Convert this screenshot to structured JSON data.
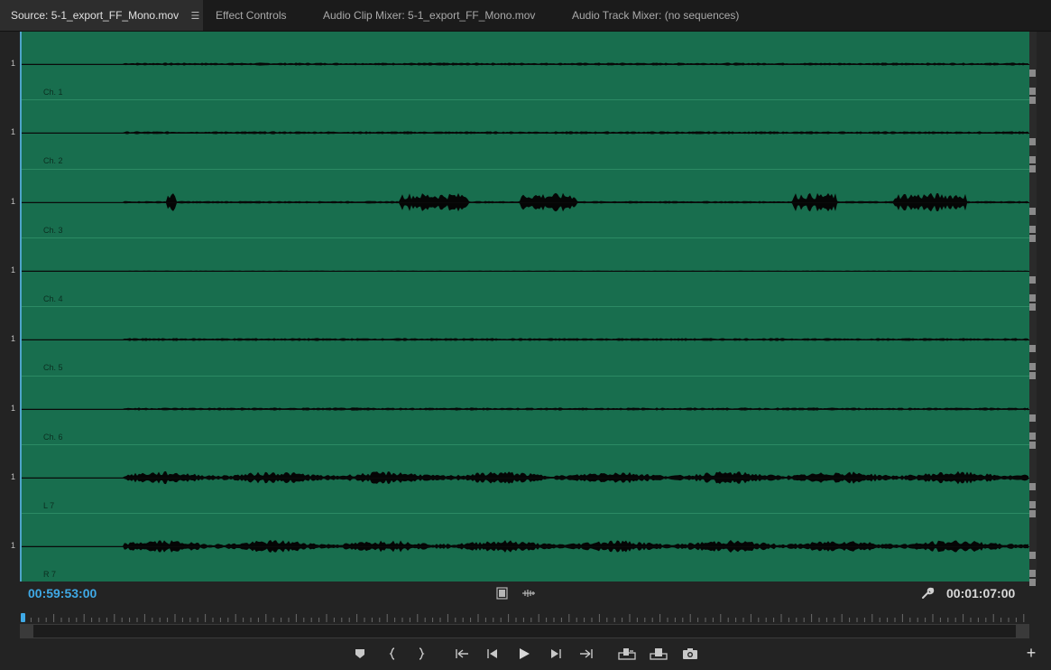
{
  "tabs": [
    {
      "label": "Source: 5-1_export_FF_Mono.mov",
      "active": true
    },
    {
      "label": "Effect Controls",
      "active": false
    },
    {
      "label": "Audio Clip Mixer: 5-1_export_FF_Mono.mov",
      "active": false
    },
    {
      "label": "Audio Track Mixer: (no sequences)",
      "active": false
    }
  ],
  "channels": [
    {
      "label": "Ch. 1",
      "scale": "1",
      "level": "low"
    },
    {
      "label": "Ch. 2",
      "scale": "1",
      "level": "low"
    },
    {
      "label": "Ch. 3",
      "scale": "1",
      "level": "bursts"
    },
    {
      "label": "Ch. 4",
      "scale": "1",
      "level": "silent"
    },
    {
      "label": "Ch. 5",
      "scale": "1",
      "level": "low"
    },
    {
      "label": "Ch. 6",
      "scale": "1",
      "level": "low"
    },
    {
      "label": "L 7",
      "scale": "1",
      "level": "high"
    },
    {
      "label": "R 7",
      "scale": "1",
      "level": "high"
    }
  ],
  "timecode_in": "00:59:53:00",
  "timecode_duration": "00:01:07:00",
  "colors": {
    "waveform_bg": "#186e4e",
    "timecode_in": "#3fa9e6",
    "playhead": "#3fa9e6"
  },
  "icons": {
    "tab_menu": "hamburger-icon",
    "center": [
      "film-icon",
      "audio-drag-icon"
    ],
    "settings": "wrench-icon",
    "add": "plus-icon"
  },
  "transport": [
    "add-marker-icon",
    "mark-in-icon",
    "mark-out-icon",
    "go-to-in-icon",
    "step-back-icon",
    "play-icon",
    "step-forward-icon",
    "go-to-out-icon",
    "insert-icon",
    "overwrite-icon",
    "export-frame-icon"
  ]
}
